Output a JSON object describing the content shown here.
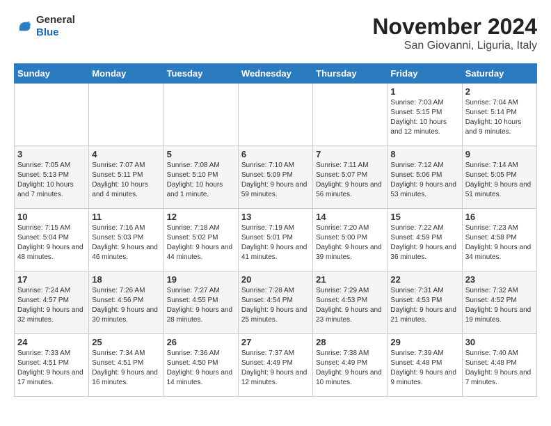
{
  "header": {
    "logo_line1": "General",
    "logo_line2": "Blue",
    "month_year": "November 2024",
    "location": "San Giovanni, Liguria, Italy"
  },
  "days_of_week": [
    "Sunday",
    "Monday",
    "Tuesday",
    "Wednesday",
    "Thursday",
    "Friday",
    "Saturday"
  ],
  "weeks": [
    {
      "cells": [
        {
          "day": "",
          "info": ""
        },
        {
          "day": "",
          "info": ""
        },
        {
          "day": "",
          "info": ""
        },
        {
          "day": "",
          "info": ""
        },
        {
          "day": "",
          "info": ""
        },
        {
          "day": "1",
          "info": "Sunrise: 7:03 AM\nSunset: 5:15 PM\nDaylight: 10 hours and 12 minutes."
        },
        {
          "day": "2",
          "info": "Sunrise: 7:04 AM\nSunset: 5:14 PM\nDaylight: 10 hours and 9 minutes."
        }
      ]
    },
    {
      "cells": [
        {
          "day": "3",
          "info": "Sunrise: 7:05 AM\nSunset: 5:13 PM\nDaylight: 10 hours and 7 minutes."
        },
        {
          "day": "4",
          "info": "Sunrise: 7:07 AM\nSunset: 5:11 PM\nDaylight: 10 hours and 4 minutes."
        },
        {
          "day": "5",
          "info": "Sunrise: 7:08 AM\nSunset: 5:10 PM\nDaylight: 10 hours and 1 minute."
        },
        {
          "day": "6",
          "info": "Sunrise: 7:10 AM\nSunset: 5:09 PM\nDaylight: 9 hours and 59 minutes."
        },
        {
          "day": "7",
          "info": "Sunrise: 7:11 AM\nSunset: 5:07 PM\nDaylight: 9 hours and 56 minutes."
        },
        {
          "day": "8",
          "info": "Sunrise: 7:12 AM\nSunset: 5:06 PM\nDaylight: 9 hours and 53 minutes."
        },
        {
          "day": "9",
          "info": "Sunrise: 7:14 AM\nSunset: 5:05 PM\nDaylight: 9 hours and 51 minutes."
        }
      ]
    },
    {
      "cells": [
        {
          "day": "10",
          "info": "Sunrise: 7:15 AM\nSunset: 5:04 PM\nDaylight: 9 hours and 48 minutes."
        },
        {
          "day": "11",
          "info": "Sunrise: 7:16 AM\nSunset: 5:03 PM\nDaylight: 9 hours and 46 minutes."
        },
        {
          "day": "12",
          "info": "Sunrise: 7:18 AM\nSunset: 5:02 PM\nDaylight: 9 hours and 44 minutes."
        },
        {
          "day": "13",
          "info": "Sunrise: 7:19 AM\nSunset: 5:01 PM\nDaylight: 9 hours and 41 minutes."
        },
        {
          "day": "14",
          "info": "Sunrise: 7:20 AM\nSunset: 5:00 PM\nDaylight: 9 hours and 39 minutes."
        },
        {
          "day": "15",
          "info": "Sunrise: 7:22 AM\nSunset: 4:59 PM\nDaylight: 9 hours and 36 minutes."
        },
        {
          "day": "16",
          "info": "Sunrise: 7:23 AM\nSunset: 4:58 PM\nDaylight: 9 hours and 34 minutes."
        }
      ]
    },
    {
      "cells": [
        {
          "day": "17",
          "info": "Sunrise: 7:24 AM\nSunset: 4:57 PM\nDaylight: 9 hours and 32 minutes."
        },
        {
          "day": "18",
          "info": "Sunrise: 7:26 AM\nSunset: 4:56 PM\nDaylight: 9 hours and 30 minutes."
        },
        {
          "day": "19",
          "info": "Sunrise: 7:27 AM\nSunset: 4:55 PM\nDaylight: 9 hours and 28 minutes."
        },
        {
          "day": "20",
          "info": "Sunrise: 7:28 AM\nSunset: 4:54 PM\nDaylight: 9 hours and 25 minutes."
        },
        {
          "day": "21",
          "info": "Sunrise: 7:29 AM\nSunset: 4:53 PM\nDaylight: 9 hours and 23 minutes."
        },
        {
          "day": "22",
          "info": "Sunrise: 7:31 AM\nSunset: 4:53 PM\nDaylight: 9 hours and 21 minutes."
        },
        {
          "day": "23",
          "info": "Sunrise: 7:32 AM\nSunset: 4:52 PM\nDaylight: 9 hours and 19 minutes."
        }
      ]
    },
    {
      "cells": [
        {
          "day": "24",
          "info": "Sunrise: 7:33 AM\nSunset: 4:51 PM\nDaylight: 9 hours and 17 minutes."
        },
        {
          "day": "25",
          "info": "Sunrise: 7:34 AM\nSunset: 4:51 PM\nDaylight: 9 hours and 16 minutes."
        },
        {
          "day": "26",
          "info": "Sunrise: 7:36 AM\nSunset: 4:50 PM\nDaylight: 9 hours and 14 minutes."
        },
        {
          "day": "27",
          "info": "Sunrise: 7:37 AM\nSunset: 4:49 PM\nDaylight: 9 hours and 12 minutes."
        },
        {
          "day": "28",
          "info": "Sunrise: 7:38 AM\nSunset: 4:49 PM\nDaylight: 9 hours and 10 minutes."
        },
        {
          "day": "29",
          "info": "Sunrise: 7:39 AM\nSunset: 4:48 PM\nDaylight: 9 hours and 9 minutes."
        },
        {
          "day": "30",
          "info": "Sunrise: 7:40 AM\nSunset: 4:48 PM\nDaylight: 9 hours and 7 minutes."
        }
      ]
    }
  ]
}
